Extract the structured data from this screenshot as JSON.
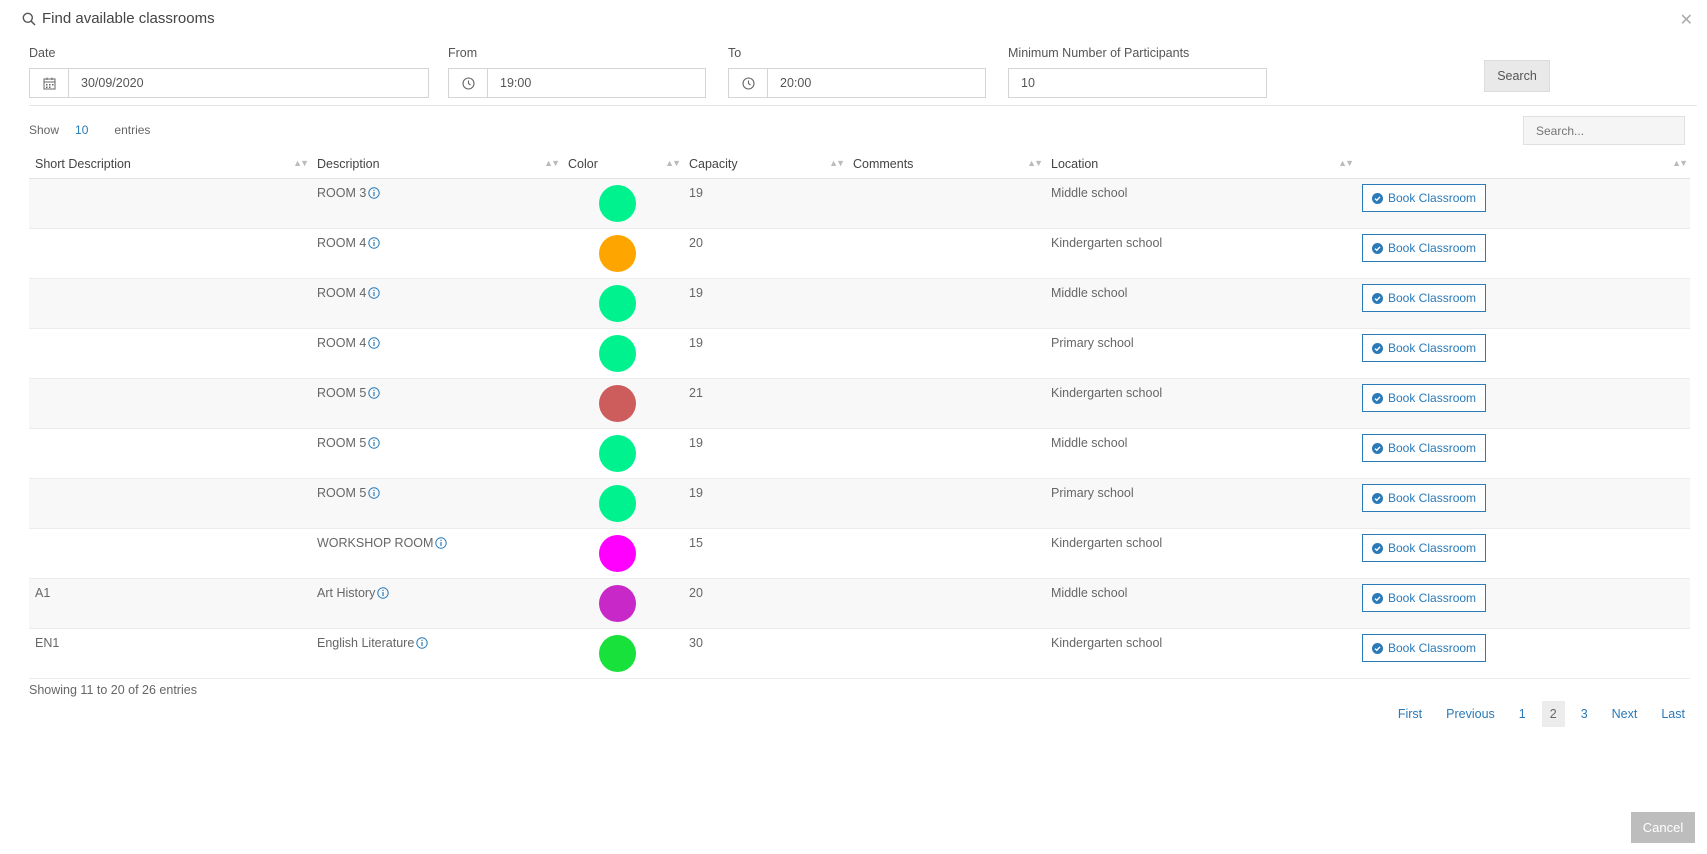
{
  "dialog": {
    "title": "Find available classrooms"
  },
  "filters": {
    "date_label": "Date",
    "date_value": "30/09/2020",
    "from_label": "From",
    "from_value": "19:00",
    "to_label": "To",
    "to_value": "20:00",
    "participants_label": "Minimum Number of Participants",
    "participants_value": "10",
    "search_label": "Search"
  },
  "table": {
    "show_label": "Show",
    "length_value": "10",
    "entries_label": "entries",
    "search_placeholder": "Search...",
    "columns": [
      "Short Description",
      "Description",
      "Color",
      "Capacity",
      "Comments",
      "Location",
      ""
    ],
    "book_label": "Book Classroom",
    "rows": [
      {
        "short": "",
        "description": "ROOM 3",
        "color": "#00f28f",
        "capacity": "19",
        "comments": "",
        "location": "Middle school"
      },
      {
        "short": "",
        "description": "ROOM 4",
        "color": "#ffa500",
        "capacity": "20",
        "comments": "",
        "location": "Kindergarten school"
      },
      {
        "short": "",
        "description": "ROOM 4",
        "color": "#00f28f",
        "capacity": "19",
        "comments": "",
        "location": "Middle school"
      },
      {
        "short": "",
        "description": "ROOM 4",
        "color": "#00f28f",
        "capacity": "19",
        "comments": "",
        "location": "Primary school"
      },
      {
        "short": "",
        "description": "ROOM 5",
        "color": "#cd5c5c",
        "capacity": "21",
        "comments": "",
        "location": "Kindergarten school"
      },
      {
        "short": "",
        "description": "ROOM 5",
        "color": "#00f28f",
        "capacity": "19",
        "comments": "",
        "location": "Middle school"
      },
      {
        "short": "",
        "description": "ROOM 5",
        "color": "#00f28f",
        "capacity": "19",
        "comments": "",
        "location": "Primary school"
      },
      {
        "short": "",
        "description": "WORKSHOP ROOM",
        "color": "#ff00ff",
        "capacity": "15",
        "comments": "",
        "location": "Kindergarten school"
      },
      {
        "short": "A1",
        "description": "Art History",
        "color": "#c928c9",
        "capacity": "20",
        "comments": "",
        "location": "Middle school"
      },
      {
        "short": "EN1",
        "description": "English Literature",
        "color": "#17e13a",
        "capacity": "30",
        "comments": "",
        "location": "Kindergarten school"
      }
    ],
    "summary": "Showing 11 to 20 of 26 entries"
  },
  "pagination": {
    "first": "First",
    "previous": "Previous",
    "pages": [
      "1",
      "2",
      "3"
    ],
    "active_page": "2",
    "next": "Next",
    "last": "Last"
  },
  "footer": {
    "cancel_label": "Cancel"
  }
}
